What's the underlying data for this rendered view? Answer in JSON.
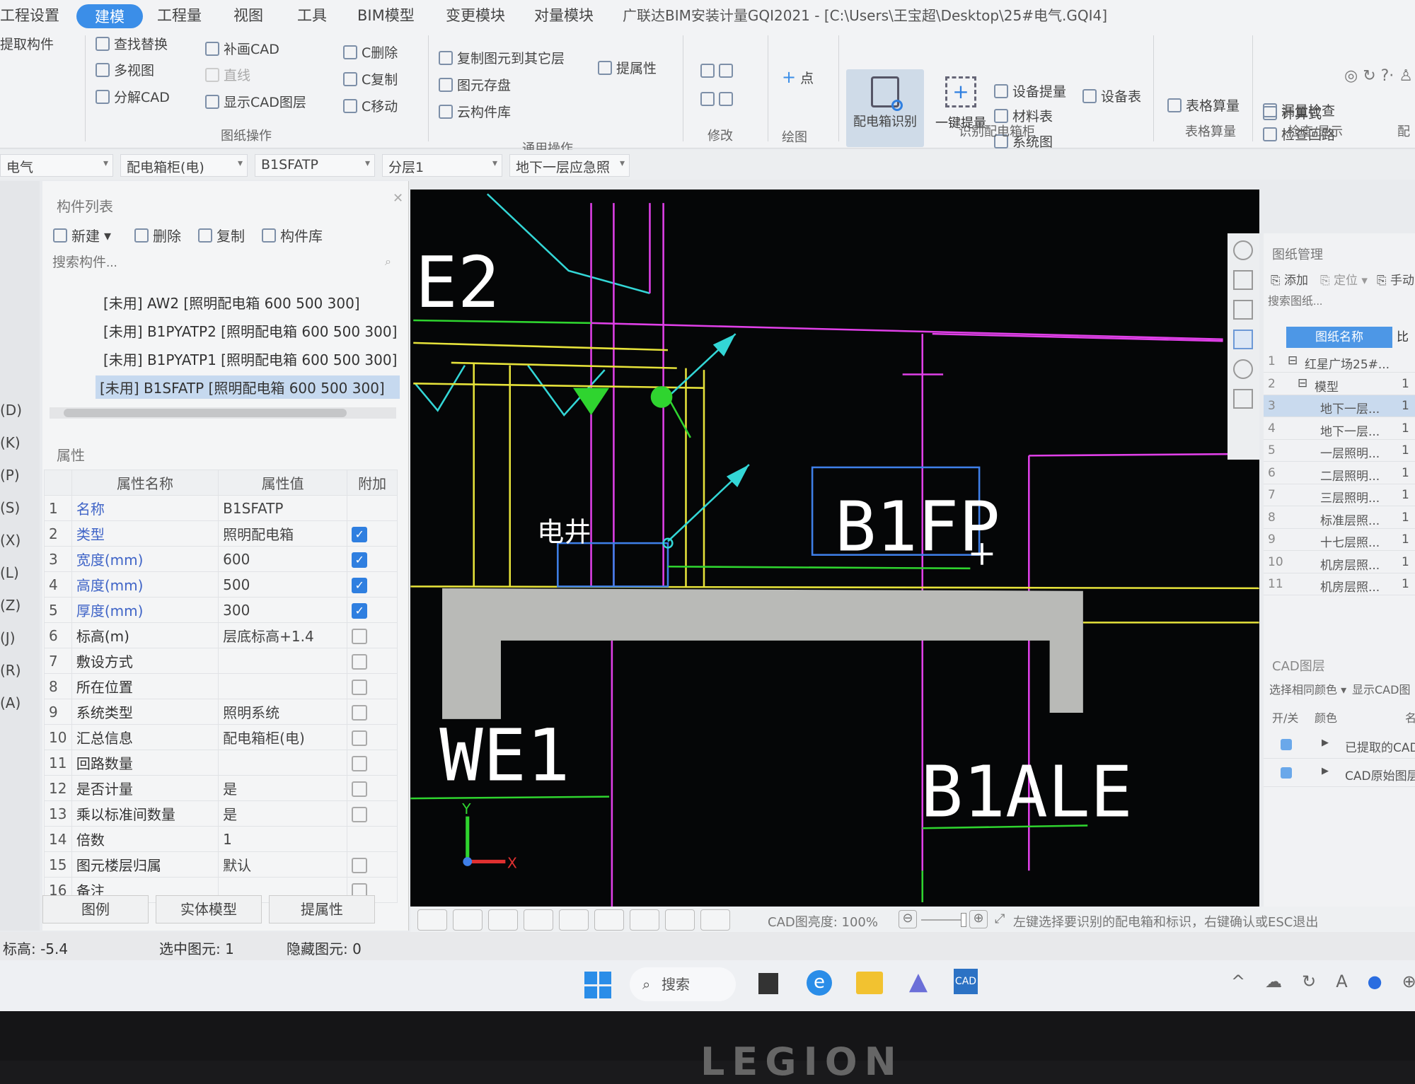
{
  "window": {
    "title": "广联达BIM安装计量GQI2021 - [C:\\Users\\王宝超\\Desktop\\25#电气.GQI4]"
  },
  "tabs": [
    "工程设置",
    "建模",
    "工程量",
    "视图",
    "工具",
    "BIM模型",
    "变更模块",
    "对量模块"
  ],
  "active_tab": "建模",
  "ribbon": {
    "extract": "提取构件",
    "drawing_ops": {
      "items": [
        "查找替换",
        "多视图",
        "分解CAD",
        "补画CAD",
        "直线",
        "显示CAD图层",
        "C删除",
        "C复制",
        "C移动"
      ],
      "group": "图纸操作"
    },
    "general_ops": {
      "items": [
        "复制图元到其它层",
        "提属性",
        "图元存盘",
        "云构件库"
      ],
      "group": "通用操作"
    },
    "modify": {
      "group": "修改"
    },
    "draw": {
      "point": "点",
      "group": "绘图"
    },
    "identify": {
      "main": "配电箱识别",
      "one_key": "一键提量",
      "items": [
        "设备提量",
        "材料表",
        "系统图",
        "设备表"
      ],
      "group": "识别配电箱柜"
    },
    "table_calc": {
      "item": "表格算量",
      "group": "表格算量"
    },
    "check": {
      "items": [
        "漏量检查",
        "检查回路",
        "计算式"
      ],
      "group": "检查/显示"
    },
    "partial": "配"
  },
  "selectors": [
    "电气",
    "配电箱柜(电)",
    "B1SFATP",
    "分层1",
    "地下一层应急照"
  ],
  "left_keys": [
    "(D)",
    "(K)",
    "(P)",
    "(S)",
    "(X)",
    "(L)",
    "(Z)",
    "(J)",
    "(R)",
    "(A)"
  ],
  "component_list": {
    "title": "构件列表",
    "toolbar": [
      "新建",
      "删除",
      "复制",
      "构件库"
    ],
    "search_placeholder": "搜索构件...",
    "items": [
      "[未用] AW2 [照明配电箱 600 500 300]",
      "[未用] B1PYATP2 [照明配电箱 600 500 300]",
      "[未用] B1PYATP1 [照明配电箱 600 500 300]",
      "[未用] B1SFATP [照明配电箱 600 500 300]"
    ],
    "selected_index": 3
  },
  "properties": {
    "title": "属性",
    "headers": [
      "属性名称",
      "属性值",
      "附加"
    ],
    "rows": [
      {
        "n": "1",
        "name": "名称",
        "value": "B1SFATP",
        "blue": true,
        "check": null
      },
      {
        "n": "2",
        "name": "类型",
        "value": "照明配电箱",
        "blue": true,
        "check": true
      },
      {
        "n": "3",
        "name": "宽度(mm)",
        "value": "600",
        "blue": true,
        "check": true
      },
      {
        "n": "4",
        "name": "高度(mm)",
        "value": "500",
        "blue": true,
        "check": true
      },
      {
        "n": "5",
        "name": "厚度(mm)",
        "value": "300",
        "blue": true,
        "check": true
      },
      {
        "n": "6",
        "name": "标高(m)",
        "value": "层底标高+1.4",
        "blue": false,
        "check": false
      },
      {
        "n": "7",
        "name": "敷设方式",
        "value": "",
        "blue": false,
        "check": false
      },
      {
        "n": "8",
        "name": "所在位置",
        "value": "",
        "blue": false,
        "check": false
      },
      {
        "n": "9",
        "name": "系统类型",
        "value": "照明系统",
        "blue": false,
        "check": false
      },
      {
        "n": "10",
        "name": "汇总信息",
        "value": "配电箱柜(电)",
        "blue": false,
        "check": false
      },
      {
        "n": "11",
        "name": "回路数量",
        "value": "",
        "blue": false,
        "check": false
      },
      {
        "n": "12",
        "name": "是否计量",
        "value": "是",
        "blue": false,
        "check": false
      },
      {
        "n": "13",
        "name": "乘以标准间数量",
        "value": "是",
        "blue": false,
        "check": false
      },
      {
        "n": "14",
        "name": "倍数",
        "value": "1",
        "blue": false,
        "check": null
      },
      {
        "n": "15",
        "name": "图元楼层归属",
        "value": "默认",
        "blue": false,
        "check": false
      },
      {
        "n": "16",
        "name": "备注",
        "value": "",
        "blue": false,
        "check": false
      }
    ],
    "buttons": [
      "图例",
      "实体模型",
      "提属性"
    ]
  },
  "status": {
    "elevation": "标高: -5.4",
    "selected": "选中图元: 1",
    "hidden": "隐藏图元: 0"
  },
  "canvas": {
    "labels": {
      "e2": "E2",
      "b1fp": "B1FP",
      "we1": "WE1",
      "b1ale": "B1ALE",
      "shaft": "电井",
      "axis_x": "X",
      "axis_y": "Y"
    },
    "colors": {
      "background": "#050607",
      "magenta": "#e040e8",
      "yellow": "#e6e23a",
      "green": "#2fd42f",
      "cyan": "#33d6d6",
      "blue": "#3f7fe8",
      "slab": "#b9bab7"
    }
  },
  "cad_bar": {
    "brightness": "CAD图亮度: 100%",
    "hint": "左键选择要识别的配电箱和标识，右键确认或ESC退出"
  },
  "drawing_mgmt": {
    "title": "图纸管理",
    "toolbar": [
      "添加",
      "定位",
      "手动"
    ],
    "search_placeholder": "搜索图纸...",
    "headers": [
      "图纸名称",
      "比"
    ],
    "rows": [
      {
        "n": "1",
        "name": "红星广场25#...",
        "scale": "",
        "indent": 0,
        "tree": "⊟"
      },
      {
        "n": "2",
        "name": "模型",
        "scale": "1",
        "indent": 1,
        "tree": "⊟"
      },
      {
        "n": "3",
        "name": "地下一层...",
        "scale": "1",
        "indent": 2,
        "tree": ""
      },
      {
        "n": "4",
        "name": "地下一层...",
        "scale": "1",
        "indent": 2,
        "tree": ""
      },
      {
        "n": "5",
        "name": "一层照明...",
        "scale": "1",
        "indent": 2,
        "tree": ""
      },
      {
        "n": "6",
        "name": "二层照明...",
        "scale": "1",
        "indent": 2,
        "tree": ""
      },
      {
        "n": "7",
        "name": "三层照明...",
        "scale": "1",
        "indent": 2,
        "tree": ""
      },
      {
        "n": "8",
        "name": "标准层照...",
        "scale": "1",
        "indent": 2,
        "tree": ""
      },
      {
        "n": "9",
        "name": "十七层照...",
        "scale": "1",
        "indent": 2,
        "tree": ""
      },
      {
        "n": "10",
        "name": "机房层照...",
        "scale": "1",
        "indent": 2,
        "tree": ""
      },
      {
        "n": "11",
        "name": "机房层照...",
        "scale": "1",
        "indent": 2,
        "tree": ""
      }
    ],
    "selected_index": 2
  },
  "cad_layers": {
    "title": "CAD图层",
    "toolbar": [
      "选择相同颜色",
      "显示CAD图"
    ],
    "headers": [
      "开/关",
      "颜色",
      "名"
    ],
    "rows": [
      "已提取的CAD",
      "CAD原始图层"
    ]
  },
  "taskbar": {
    "search": "搜索",
    "apps": [
      "windows-start",
      "task-view",
      "edge",
      "file-explorer",
      "gqi-app",
      "cad-app"
    ]
  },
  "bezel": {
    "brand": "LEGION"
  }
}
